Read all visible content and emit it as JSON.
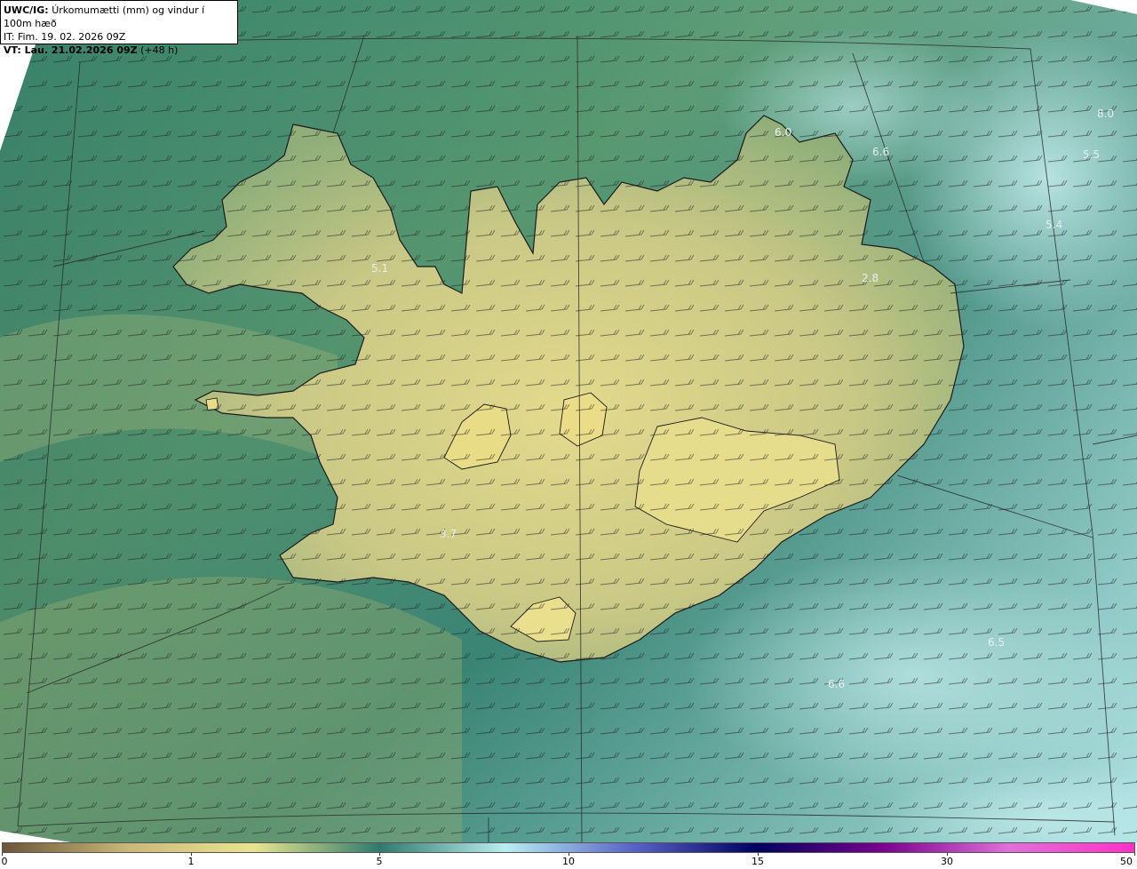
{
  "title": {
    "model": "UWC/IG:",
    "description": "Úrkomumætti (mm) og vindur í 100m hæð",
    "initial_time": "IT: Fim. 19. 02. 2026 09Z",
    "valid_label": "VT: Lau. 21.02.2026 09Z",
    "valid_offset": "(+48 h)"
  },
  "map_labels": [
    {
      "id": "northeast-sea-1",
      "text": "8.0"
    },
    {
      "id": "northeast-sea-2",
      "text": "5.5"
    },
    {
      "id": "northeast-sea-3",
      "text": "5.4"
    },
    {
      "id": "north-coast",
      "text": "6.6"
    },
    {
      "id": "east-inland",
      "text": "2.8"
    },
    {
      "id": "westfjords",
      "text": "5.1"
    },
    {
      "id": "southwest-inland",
      "text": "3.7"
    },
    {
      "id": "southeast-sea-1",
      "text": "6.5"
    },
    {
      "id": "southeast-sea-2",
      "text": "6.6"
    },
    {
      "id": "north-sea-small",
      "text": "6.0"
    }
  ],
  "colorbar": {
    "ticks": [
      "0",
      "1",
      "5",
      "10",
      "15",
      "30",
      "50"
    ],
    "colors": [
      "#6a5638",
      "#c9b878",
      "#e9e58e",
      "#2f7a6c",
      "#b9eef0",
      "#5a64c8",
      "#000060",
      "#7a0090",
      "#e070d8",
      "#ff30c8"
    ]
  },
  "colors": {
    "land_high": "#e2d98a",
    "land_low": "#9cb67a",
    "sea_deep": "#2e7567",
    "sea_light": "#bfeaea",
    "coastline": "#1a1a1a",
    "wind_barb": "#202020"
  }
}
